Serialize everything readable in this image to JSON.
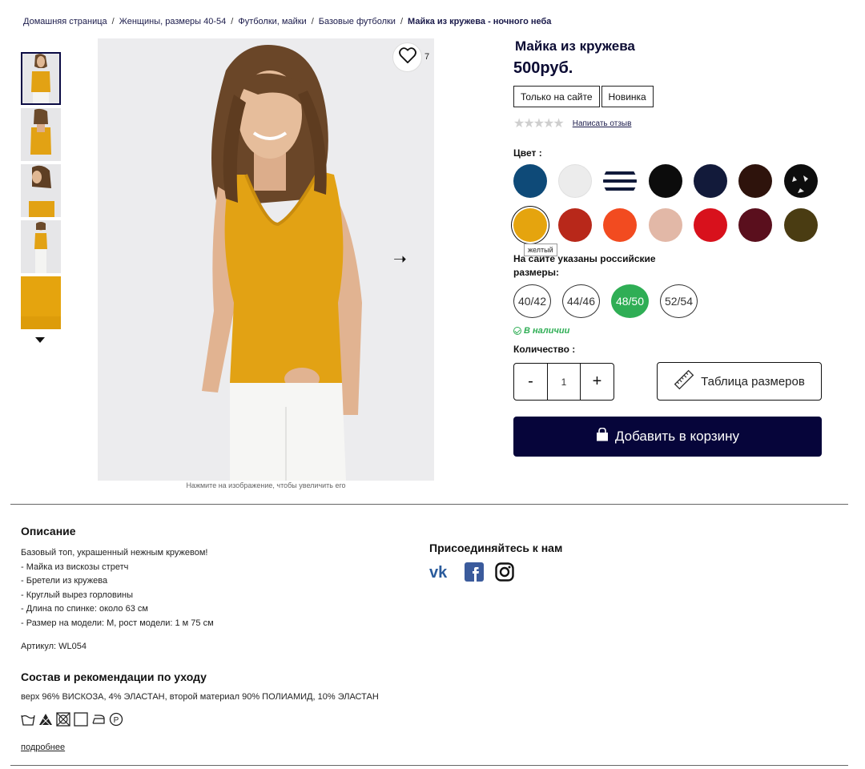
{
  "breadcrumb": {
    "items": [
      "Домашняя страница",
      "Женщины, размеры 40-54",
      "Футболки, майки",
      "Базовые футболки"
    ],
    "current": "Майка из кружева - ночного неба",
    "separator": "/"
  },
  "gallery": {
    "favorite_count": "7",
    "zoom_hint": "Нажмите на изображение, чтобы увеличить его",
    "thumbnail_count": 5
  },
  "product": {
    "title": "Майка из кружева",
    "price": "500руб.",
    "badges": [
      "Только на сайте",
      "Новинка"
    ],
    "review_link": "Написать отзыв",
    "rating_stars": "★★★★★"
  },
  "color": {
    "label": "Цвет :",
    "tooltip": "желтый",
    "swatches": [
      "#0e4a78",
      "#ececec",
      "#ffffff",
      "#0c0c0c",
      "#121a3a",
      "#2e130c",
      "#0d0d0d",
      "#e5a40e",
      "#b8281a",
      "#f24b20",
      "#e2b8a7",
      "#d8111c",
      "#5a0f1d",
      "#4a3c12"
    ],
    "selected_color": "#e5a40e"
  },
  "sizes": {
    "note": "На сайте указаны российские размеры:",
    "options": [
      "40/42",
      "44/46",
      "48/50",
      "52/54"
    ],
    "selected": "48/50",
    "stock": "В наличии"
  },
  "quantity": {
    "label": "Количество :",
    "minus": "-",
    "value": "1",
    "plus": "+"
  },
  "buttons": {
    "size_table": "Таблица размеров",
    "add_to_cart": "Добавить в корзину"
  },
  "description": {
    "title": "Описание",
    "lines": [
      "Базовый топ, украшенный нежным кружевом!",
      "- Майка из вискозы стретч",
      "- Бретели из кружева",
      "- Круглый вырез горловины",
      "- Длина по спинке: около 63 см",
      "- Размер на модели: M, рост модели: 1 м 75 см"
    ],
    "sku": "Артикул: WL054"
  },
  "composition": {
    "title": "Состав и рекомендации по уходу",
    "text": "верх 96% ВИСКОЗА, 4% ЭЛАСТАН, второй материал 90% ПОЛИАМИД, 10% ЭЛАСТАН",
    "more": "подробнее"
  },
  "social": {
    "title": "Присоединяйтесь к нам",
    "icons": [
      "vk-icon",
      "facebook-icon",
      "instagram-icon"
    ],
    "colors": {
      "vk": "#2a5b9c",
      "facebook": "#3b5b9c"
    }
  },
  "colors": {
    "navy": "#06053a",
    "green": "#2fae55",
    "mustard": "#e5a40e"
  }
}
